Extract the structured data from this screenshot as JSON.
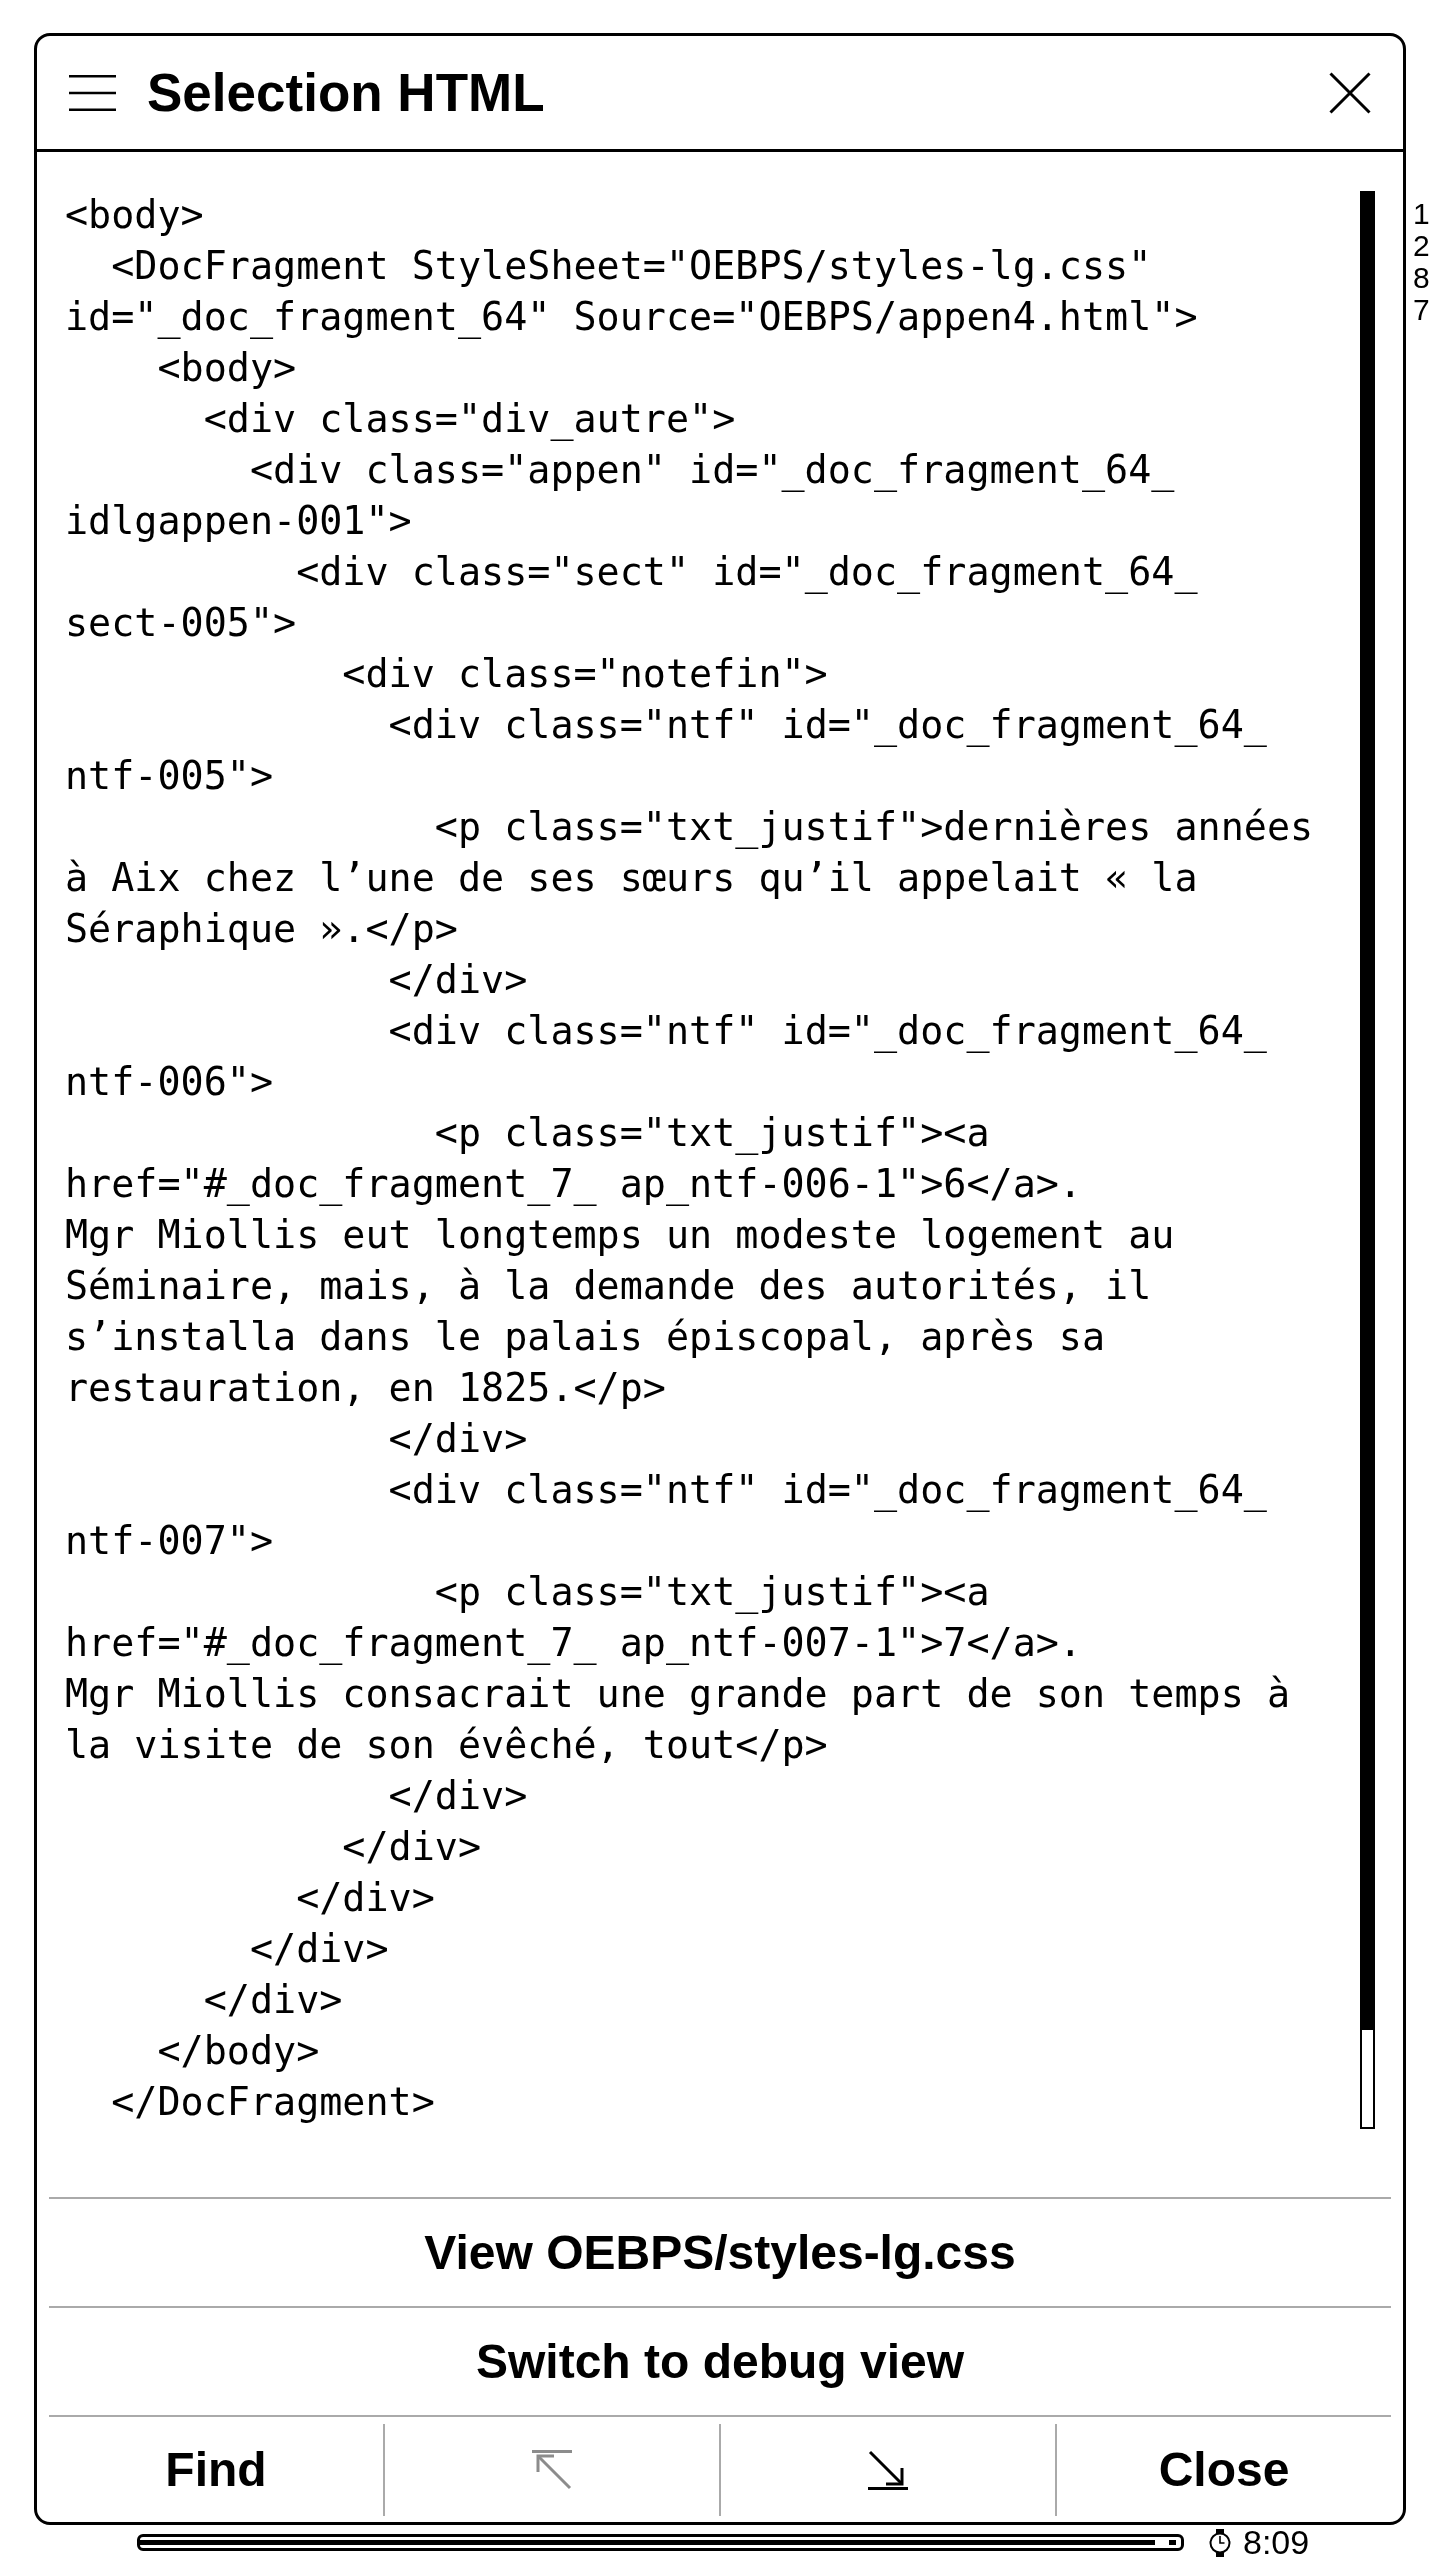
{
  "window": {
    "title": "Selection HTML"
  },
  "code_lines": [
    "<body>",
    "  <DocFragment StyleSheet=\"OEBPS/styles-lg.css\"",
    "id=\"_doc_fragment_64\" Source=\"OEBPS/appen4.html\">",
    "    <body>",
    "      <div class=\"div_autre\">",
    "        <div class=\"appen\" id=\"_doc_fragment_64_",
    "idlgappen-001\">",
    "          <div class=\"sect\" id=\"_doc_fragment_64_",
    "sect-005\">",
    "            <div class=\"notefin\">",
    "              <div class=\"ntf\" id=\"_doc_fragment_64_",
    "ntf-005\">",
    "                <p class=\"txt_justif\">dernières années",
    "à Aix chez l’une de ses sœurs qu’il appelait « la",
    "Séraphique ».</p>",
    "              </div>",
    "              <div class=\"ntf\" id=\"_doc_fragment_64_",
    "ntf-006\">",
    "                <p class=\"txt_justif\"><a",
    "href=\"#_doc_fragment_7_ ap_ntf-006-1\">6</a>.",
    "Mgr Miollis eut longtemps un modeste logement au",
    "Séminaire, mais, à la demande des autorités, il",
    "s’installa dans le palais épiscopal, après sa",
    "restauration, en 1825.</p>",
    "              </div>",
    "              <div class=\"ntf\" id=\"_doc_fragment_64_",
    "ntf-007\">",
    "                <p class=\"txt_justif\"><a",
    "href=\"#_doc_fragment_7_ ap_ntf-007-1\">7</a>.",
    "Mgr Miollis consacrait une grande part de son temps à",
    "la visite de son évêché, tout</p>",
    "              </div>",
    "            </div>",
    "          </div>",
    "        </div>",
    "      </div>",
    "    </body>",
    "  </DocFragment>"
  ],
  "page_number": "1287",
  "actions": [
    "View OEBPS/styles-lg.css",
    "Switch to debug view"
  ],
  "toolbar": [
    {
      "kind": "text",
      "label": "Find",
      "disabled": false
    },
    {
      "kind": "top",
      "disabled": true
    },
    {
      "kind": "bottom",
      "disabled": false
    },
    {
      "kind": "text",
      "label": "Close",
      "disabled": false
    }
  ],
  "status_bar": {
    "reading_progress": {
      "level": 0.975
    },
    "time": "8:09"
  }
}
